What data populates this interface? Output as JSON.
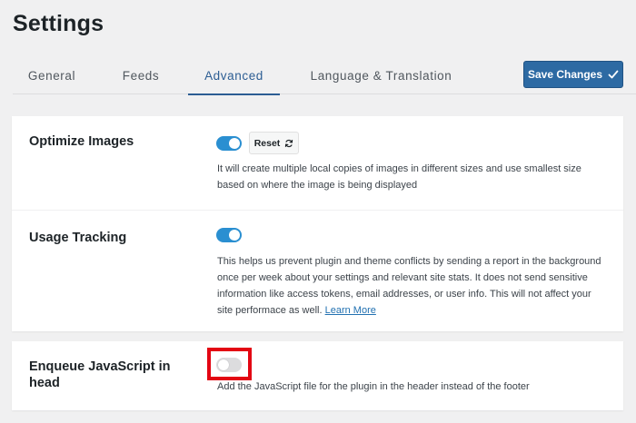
{
  "page": {
    "title": "Settings"
  },
  "tabs": [
    {
      "label": "General",
      "active": false
    },
    {
      "label": "Feeds",
      "active": false
    },
    {
      "label": "Advanced",
      "active": true
    },
    {
      "label": "Language & Translation",
      "active": false
    }
  ],
  "toolbar": {
    "save_label": "Save Changes",
    "save_icon": "checkmark-icon"
  },
  "settings": {
    "optimize_images": {
      "label": "Optimize Images",
      "enabled": true,
      "reset_label": "Reset",
      "reset_icon": "refresh-icon",
      "description": "It will create multiple local copies of images in different sizes and use smallest size based on where the image is being displayed"
    },
    "usage_tracking": {
      "label": "Usage Tracking",
      "enabled": true,
      "description": "This helps us prevent plugin and theme conflicts by sending a report in the background once per week about your settings and relevant site stats. It does not send sensitive information like access tokens, email addresses, or user info. This will not affect your site performace as well.",
      "link_label": "Learn More"
    },
    "enqueue_js": {
      "label": "Enqueue JavaScript in head",
      "enabled": false,
      "highlighted": true,
      "description": "Add the JavaScript file for the plugin in the header instead of the footer"
    }
  },
  "colors": {
    "accent": "#2d6aa3",
    "toggle_on": "#2a8fd1",
    "toggle_off": "#dcdcde",
    "highlight": "#e30613",
    "link": "#2271b1"
  }
}
